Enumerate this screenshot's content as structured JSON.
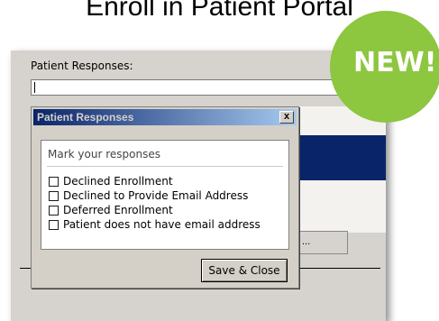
{
  "slide": {
    "title": "Enroll in Patient Portal"
  },
  "badge": {
    "label": "NEW!",
    "color": "#8dc63f"
  },
  "background_form": {
    "label": "Patient Responses:",
    "input_value": "",
    "button_label": "..."
  },
  "dialog": {
    "title": "Patient Responses",
    "close_label": "x",
    "group_caption": "Mark your responses",
    "options": [
      {
        "label": "Declined Enrollment",
        "checked": false
      },
      {
        "label": "Declined to Provide Email Address",
        "checked": false
      },
      {
        "label": "Deferred Enrollment",
        "checked": false
      },
      {
        "label": "Patient does not have email address",
        "checked": false
      }
    ],
    "save_label": "Save & Close"
  },
  "colors": {
    "titlebar": "#0a246a",
    "selection": "#0a246a",
    "dialog_face": "#d4d0c8"
  }
}
